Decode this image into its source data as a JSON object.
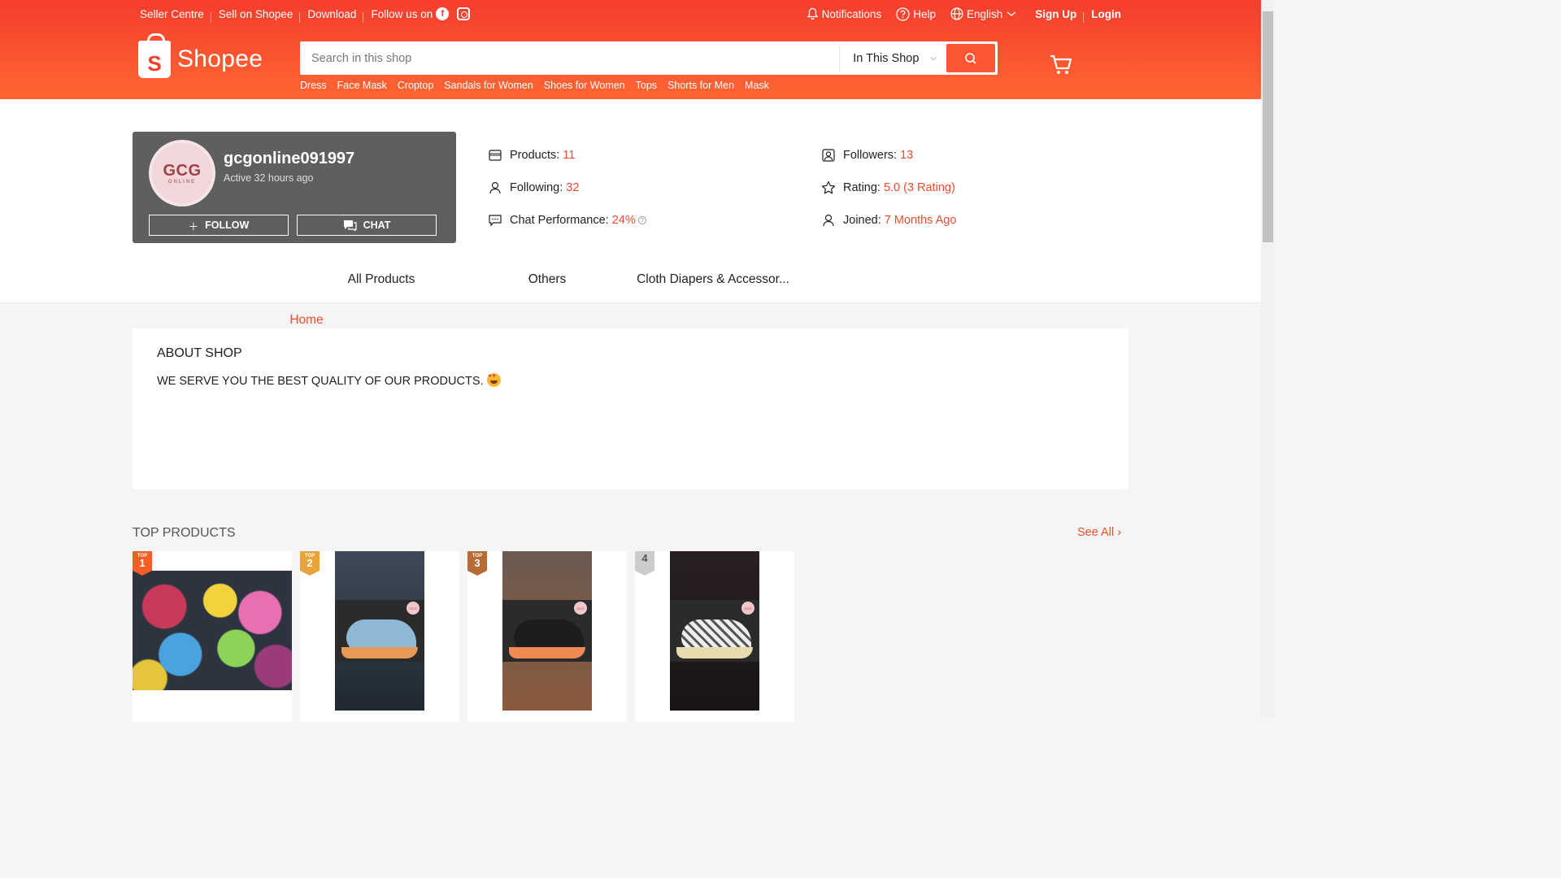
{
  "topbar": {
    "seller_centre": "Seller Centre",
    "sell_on_shopee": "Sell on Shopee",
    "download": "Download",
    "follow_us": "Follow us on",
    "notifications": "Notifications",
    "help": "Help",
    "language": "English",
    "sign_up": "Sign Up",
    "login": "Login"
  },
  "brand": {
    "name": "Shopee",
    "color": "#ee4d2d"
  },
  "search": {
    "placeholder": "Search in this shop",
    "scope": "In This Shop",
    "hints": [
      "Dress",
      "Face Mask",
      "Croptop",
      "Sandals for Women",
      "Shoes for Women",
      "Tops",
      "Shorts for Men",
      "Mask"
    ]
  },
  "shop": {
    "logo_text": "GCG",
    "logo_subtext": "ONLINE",
    "name": "gcgonline091997",
    "active": "Active 32 hours ago",
    "follow_label": "Follow",
    "chat_label": "Chat"
  },
  "stats": {
    "products_label": "Products:",
    "products_value": "11",
    "following_label": "Following:",
    "following_value": "32",
    "chat_label": "Chat Performance:",
    "chat_value": "24%",
    "followers_label": "Followers:",
    "followers_value": "13",
    "rating_label": "Rating:",
    "rating_value": "5.0 (3 Rating)",
    "joined_label": "Joined:",
    "joined_value": "7 Months Ago"
  },
  "tabs": [
    "Home",
    "All Products",
    "Others",
    "Cloth Diapers & Accessor..."
  ],
  "about": {
    "title": "About Shop",
    "text": "WE SERVE YOU THE BEST QUALITY OF OUR PRODUCTS."
  },
  "top_products": {
    "title": "Top Products",
    "see_all": "See All",
    "items": [
      {
        "badge_top": "TOP",
        "rank": "1"
      },
      {
        "badge_top": "TOP",
        "rank": "2"
      },
      {
        "badge_top": "TOP",
        "rank": "3"
      },
      {
        "badge_top": "",
        "rank": "4"
      }
    ]
  }
}
